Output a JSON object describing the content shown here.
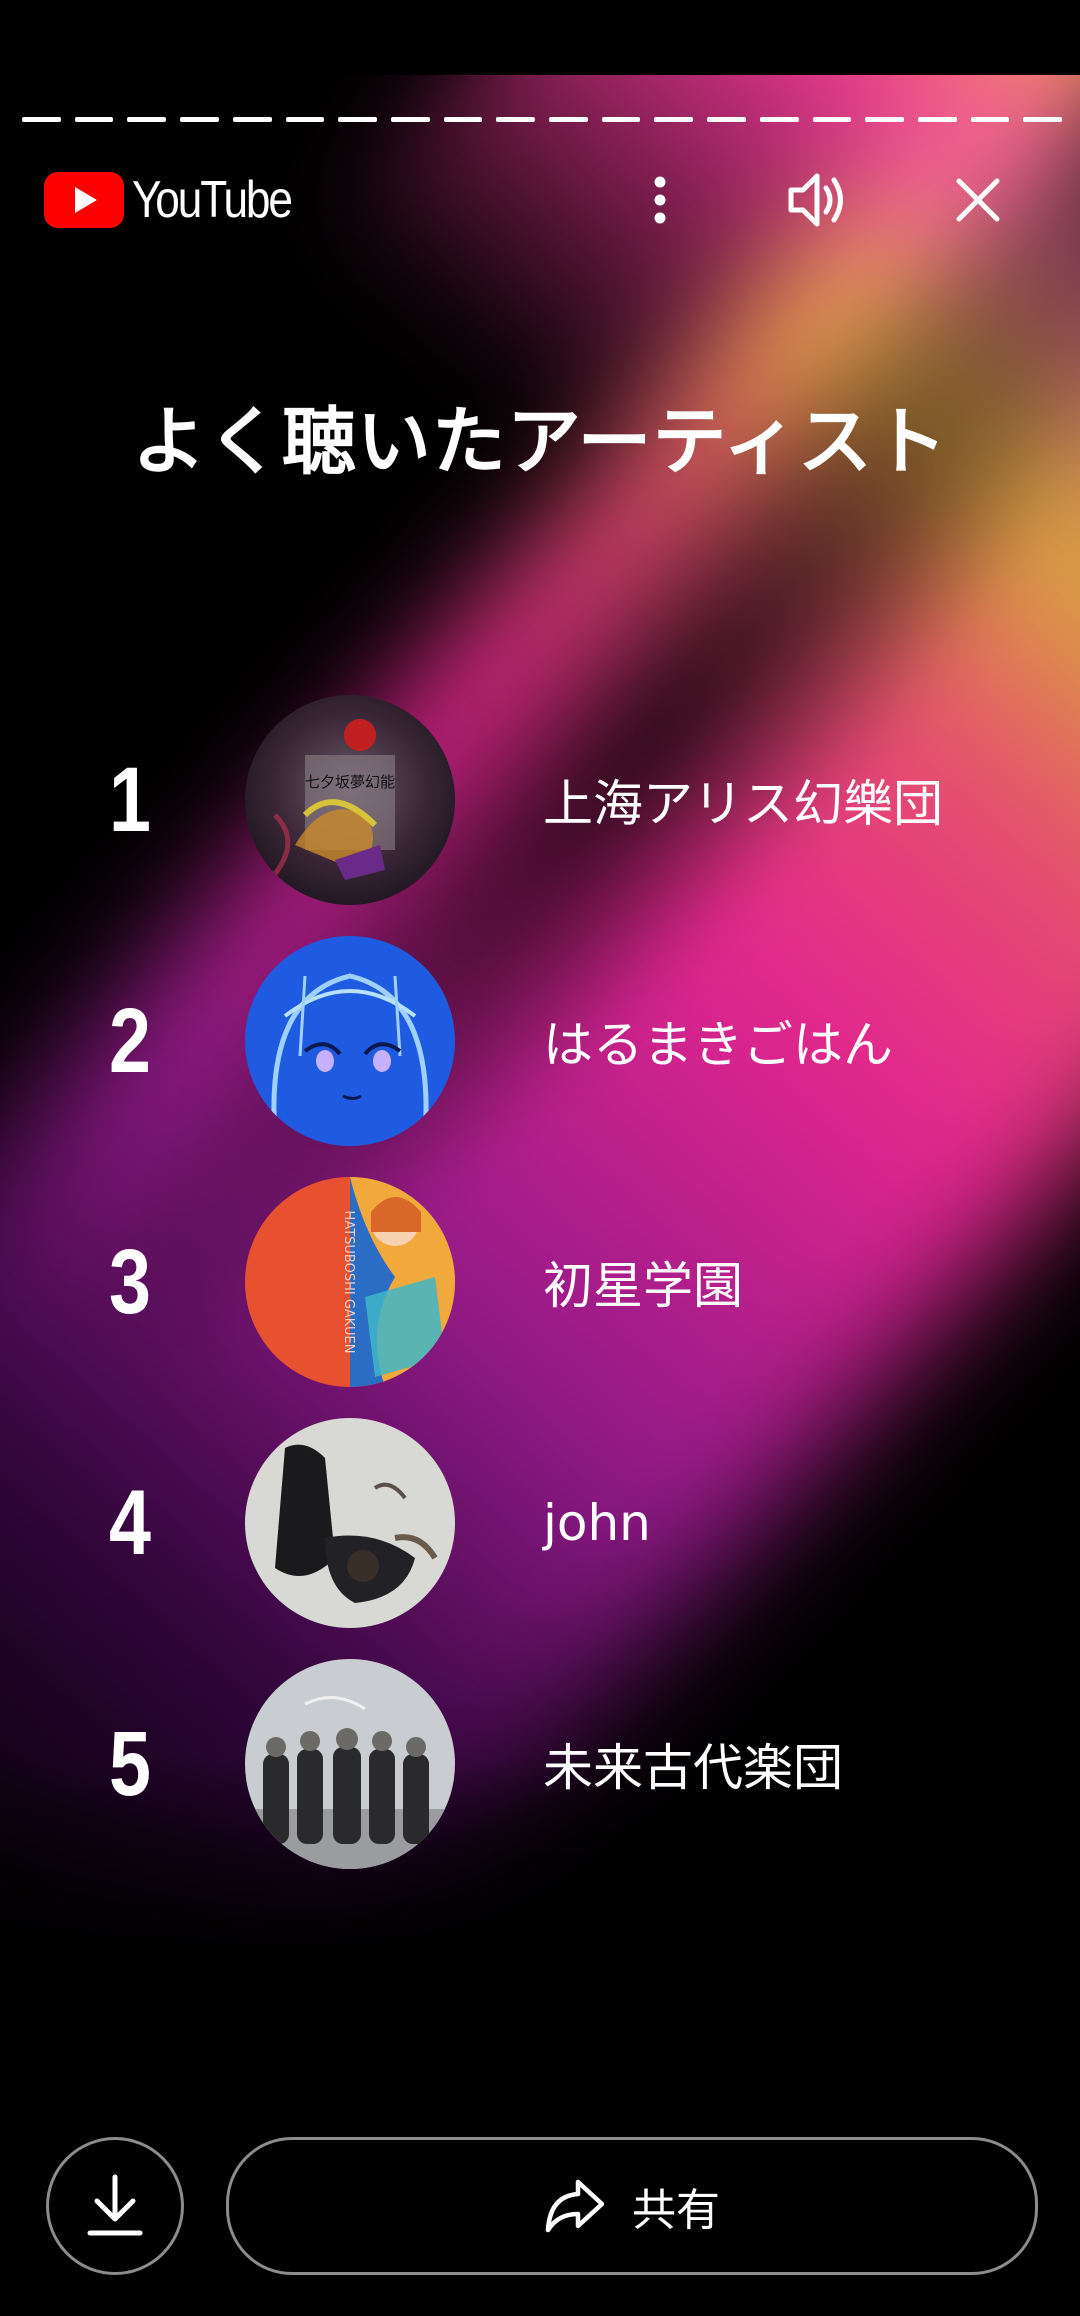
{
  "app": {
    "logo_text": "YouTube"
  },
  "progress": {
    "total_segments": 20,
    "completed_segments": 20
  },
  "topbar": {
    "more_icon": "more-vertical-icon",
    "sound_icon": "volume-icon",
    "close_icon": "close-icon"
  },
  "title": "よく聴いたアーティスト",
  "artists": [
    {
      "rank": "1",
      "name": "上海アリス幻樂団"
    },
    {
      "rank": "2",
      "name": "はるまきごはん"
    },
    {
      "rank": "3",
      "name": "初星学園"
    },
    {
      "rank": "4",
      "name": "john"
    },
    {
      "rank": "5",
      "name": "未来古代楽団"
    }
  ],
  "album_texts": {
    "artist1": "七夕坂夢幻能",
    "artist3": "HATSUBOSHI GAKUEN"
  },
  "actions": {
    "download_icon": "download-icon",
    "share_icon": "share-icon",
    "share_label": "共有"
  },
  "colors": {
    "youtube_red": "#ff0000",
    "gradient_pink": "#f02896",
    "gradient_yellow": "#ffc846",
    "gradient_purple": "#aa1ea0"
  }
}
